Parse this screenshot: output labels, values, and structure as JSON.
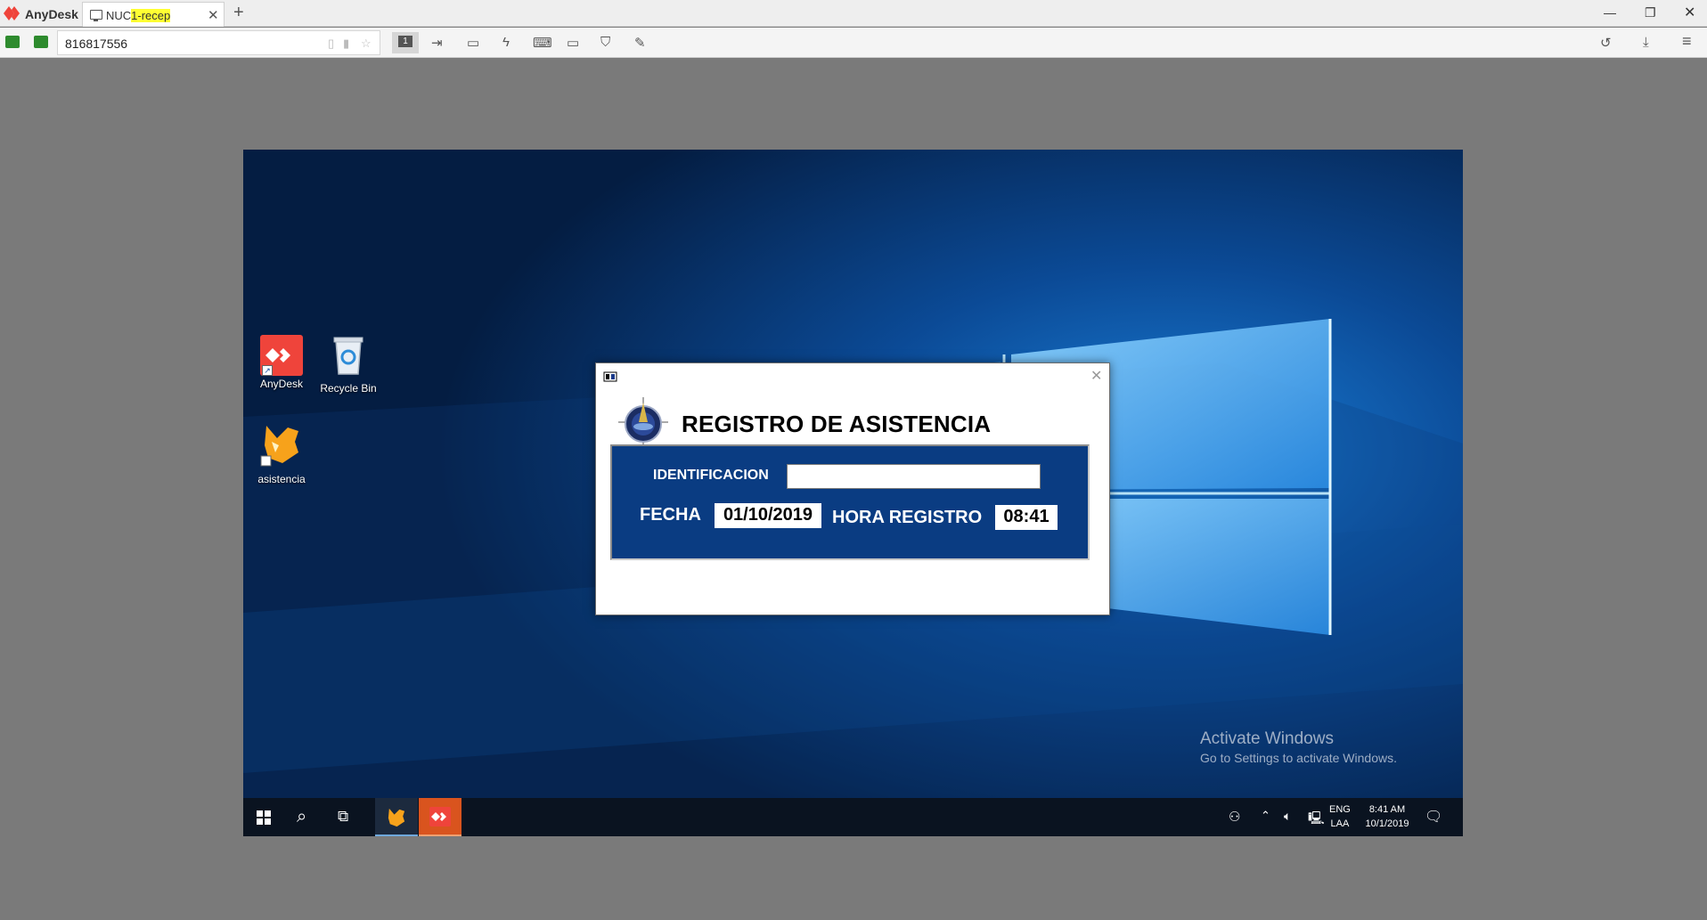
{
  "anydesk": {
    "app_name": "AnyDesk",
    "tab": {
      "label_prefix": "NUC",
      "label_highlight": "1-recep"
    },
    "address": "816817556",
    "colors": {
      "brand": "#ef443b",
      "highlight": "#ffff33"
    }
  },
  "desktop": {
    "icons": [
      {
        "label": "AnyDesk",
        "icon": "anydesk-icon"
      },
      {
        "label": "Recycle Bin",
        "icon": "recycle-bin-icon"
      },
      {
        "label": "asistencia",
        "icon": "fox-icon"
      }
    ],
    "watermark": {
      "title": "Activate Windows",
      "subtitle": "Go to Settings to activate Windows."
    }
  },
  "taskbar": {
    "language": "ENG",
    "layout": "LAA",
    "time": "8:41 AM",
    "date": "10/1/2019"
  },
  "dialog": {
    "title": "REGISTRO DE ASISTENCIA",
    "id_label": "IDENTIFICACION",
    "id_value": "",
    "fecha_label": "FECHA",
    "fecha_value": "01/10/2019",
    "hora_label": "HORA REGISTRO",
    "hora_value": "08:41",
    "colors": {
      "panel": "#0a3c82"
    }
  }
}
